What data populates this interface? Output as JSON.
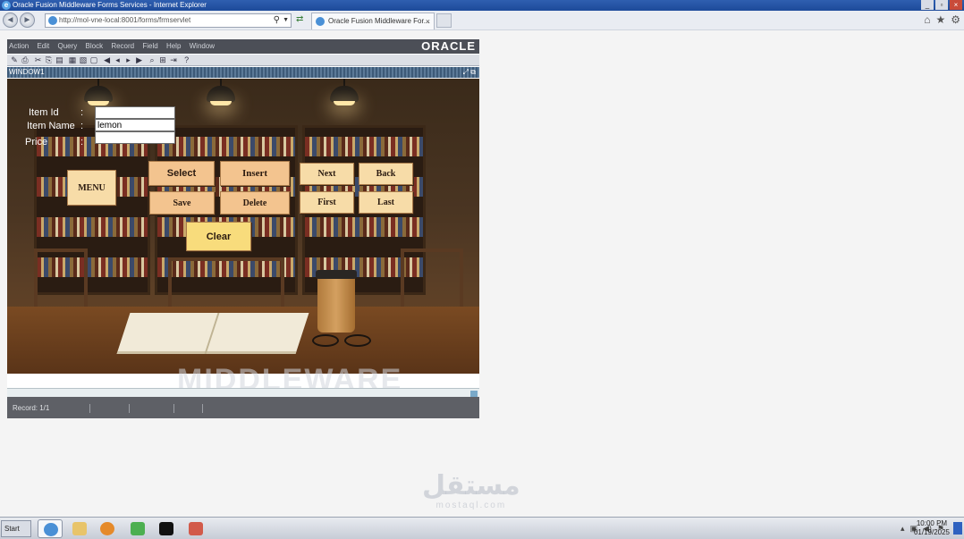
{
  "browser": {
    "title": "Oracle Fusion Middleware Forms Services - Internet Explorer",
    "address": "http://mol-vne-local:8001/forms/frmservlet",
    "tab_title": "Oracle Fusion Middleware For...",
    "window_buttons": [
      "_",
      "▫",
      "×"
    ]
  },
  "forms_menu": [
    "Action",
    "Edit",
    "Query",
    "Block",
    "Record",
    "Field",
    "Help",
    "Window"
  ],
  "brand": "ORACLE",
  "window_label": "WINDOW1",
  "form": {
    "fields": [
      {
        "label": "Item Id",
        "value": ""
      },
      {
        "label": "Item Name",
        "value": "lemon"
      },
      {
        "label": "Price",
        "value": ""
      }
    ],
    "colon": ":",
    "buttons": {
      "menu": "MENU",
      "select": "Select",
      "insert": "Insert",
      "save": "Save",
      "delete": "Delete",
      "next": "Next",
      "back": "Back",
      "first": "First",
      "last": "Last",
      "clear": "Clear"
    },
    "colors": {
      "primary_button": "#f3c48f",
      "light_button": "#f7dca8",
      "clear_button": "#f8dc7c"
    }
  },
  "status_bar": {
    "record": "Record: 1/1"
  },
  "watermarks": {
    "middleware": "MIDDLEWARE",
    "site_ar": "مستقل",
    "site_lat": "mostaql.com"
  },
  "taskbar": {
    "start_label": "Start",
    "clock_time": "10:00 PM",
    "clock_date": "01/19/2025"
  }
}
